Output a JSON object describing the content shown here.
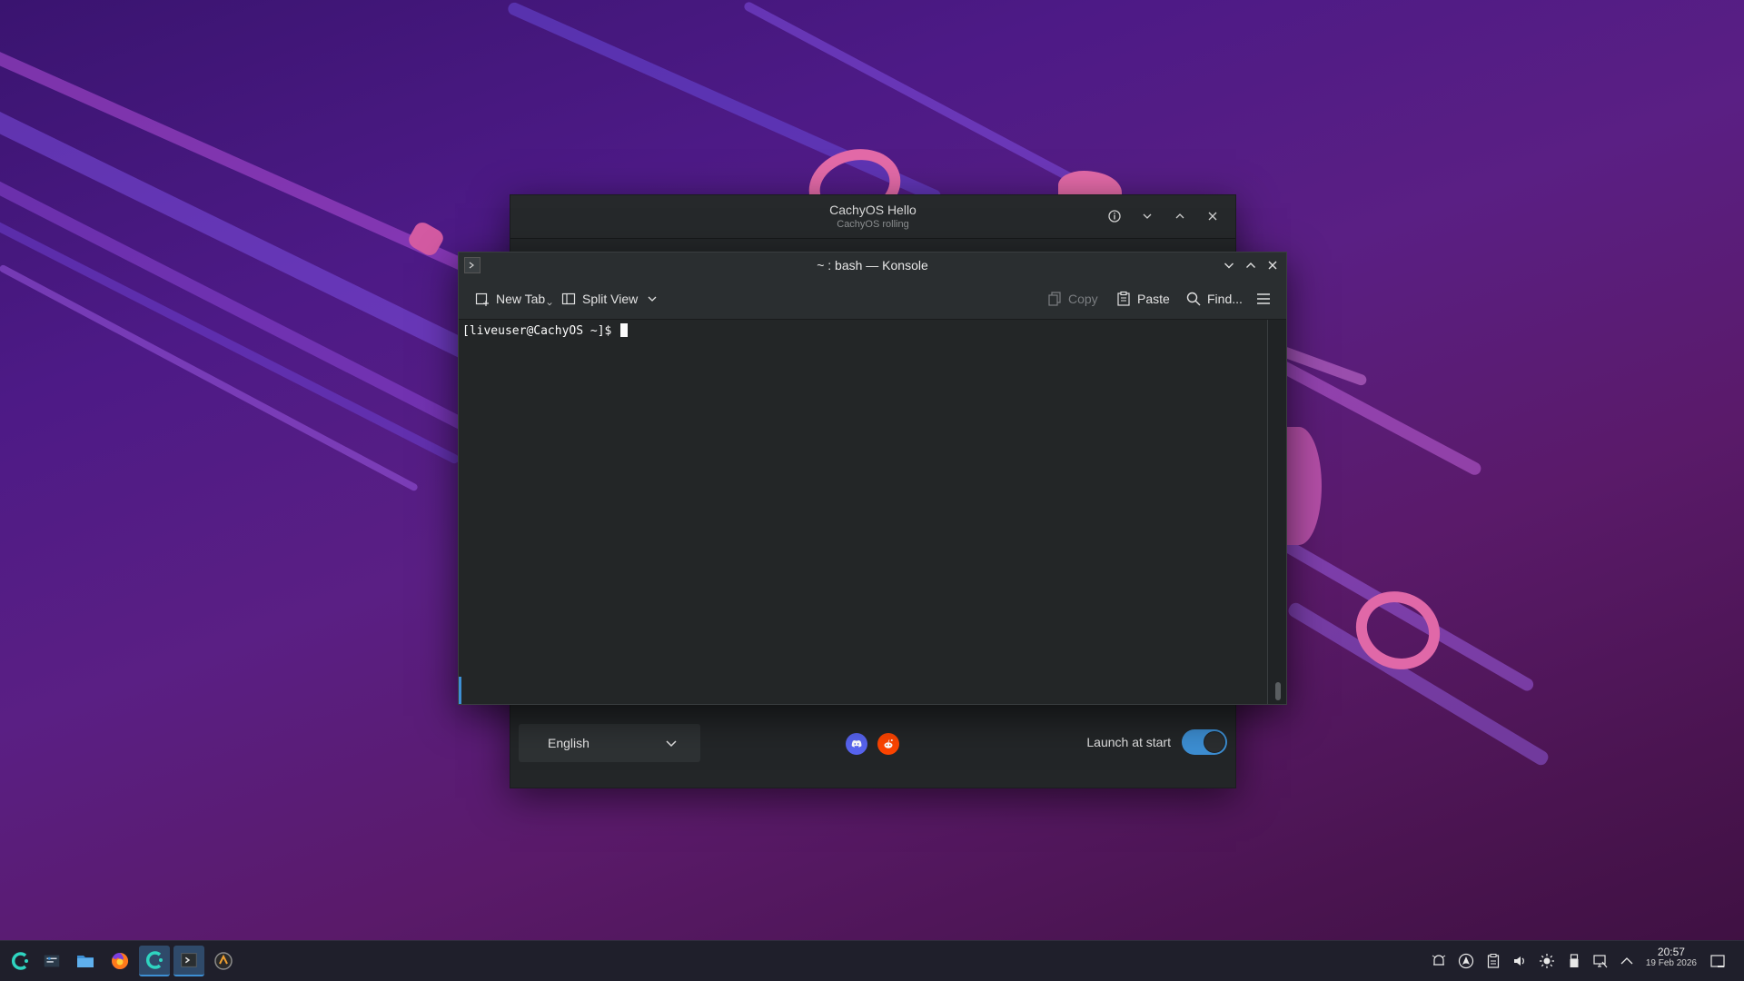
{
  "hello": {
    "title": "CachyOS Hello",
    "subtitle": "CachyOS rolling",
    "language": "English",
    "launch_label": "Launch at start"
  },
  "konsole": {
    "title": "~ : bash — Konsole",
    "toolbar": {
      "new_tab": "New Tab",
      "split_view": "Split View",
      "copy": "Copy",
      "paste": "Paste",
      "find": "Find..."
    },
    "prompt": "[liveuser@CachyOS ~]$ "
  },
  "taskbar": {
    "apps": [
      "cachyos-launcher-icon",
      "system-settings-icon",
      "file-manager-icon",
      "firefox-icon",
      "cachyos-hello-icon",
      "konsole-icon",
      "installer-icon"
    ],
    "tray_icons": [
      "notifications-icon",
      "arch-update-icon",
      "clipboard-icon",
      "volume-icon",
      "brightness-icon",
      "usb-icon",
      "network-icon",
      "tray-expand-icon"
    ],
    "time": "20:57",
    "date": "19 Feb 2026"
  },
  "colors": {
    "accent": "#3d8fd4",
    "window_bg": "#232627",
    "discord": "#5865f2",
    "reddit": "#ff4500"
  }
}
